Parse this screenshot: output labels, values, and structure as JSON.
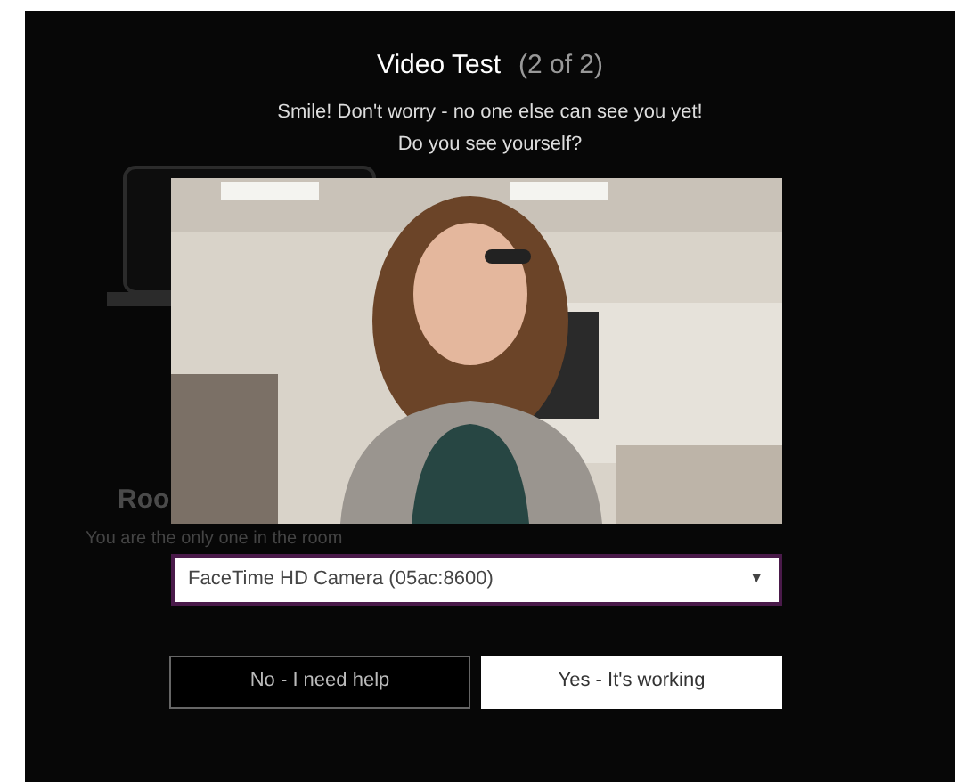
{
  "background": {
    "heading": "Roo",
    "message": "You are the only one in the room"
  },
  "dialog": {
    "title": "Video Test",
    "step": "(2 of 2)",
    "subtitle": "Smile! Don't worry - no one else can see you yet!",
    "question": "Do you see yourself?",
    "camera_select": {
      "value": "FaceTime HD Camera (05ac:8600)",
      "caret": "▼"
    },
    "buttons": [
      {
        "label": "No - I need help",
        "kind": "secondary"
      },
      {
        "label": "Yes - It's working",
        "kind": "primary"
      }
    ]
  }
}
